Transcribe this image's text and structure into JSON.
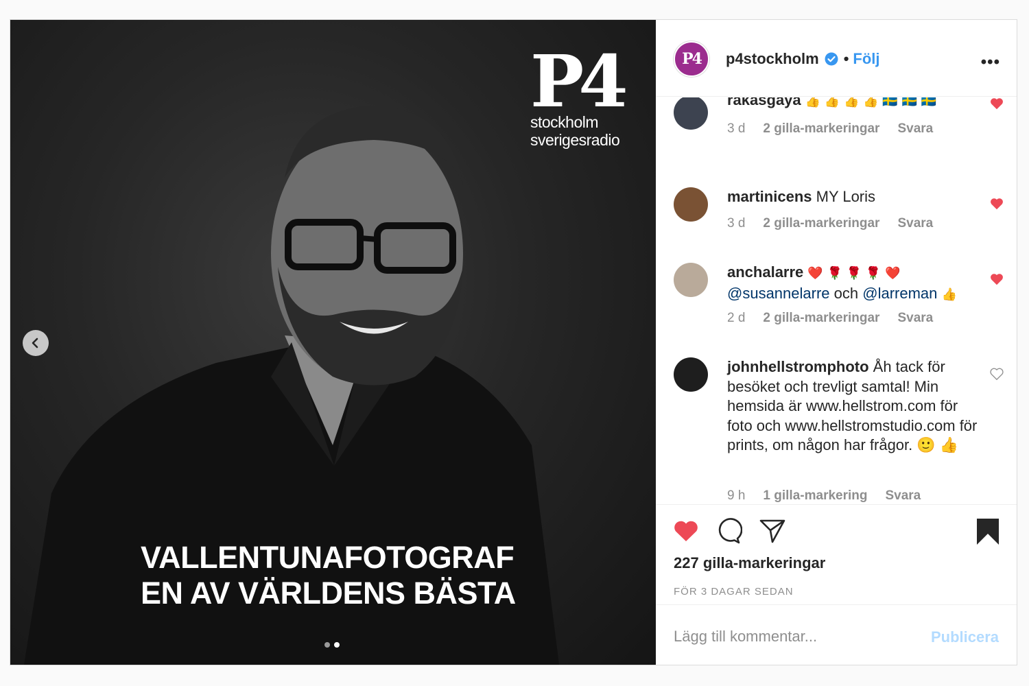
{
  "post": {
    "headline_line1": "VALLENTUNAFOTOGRAF",
    "headline_line2": "EN AV VÄRLDENS BÄSTA",
    "logo": {
      "mark": "P4",
      "line1": "stockholm",
      "line2": "sverigesradio"
    },
    "carousel": {
      "count": 2,
      "active_index": 1
    }
  },
  "header": {
    "username": "p4stockholm",
    "follow_label": "Följ",
    "more_label": "•••",
    "avatar_mark": "P4"
  },
  "comments": [
    {
      "user": "rakasgaya",
      "text": "👍 👍 👍 👍 🇸🇪 🇸🇪 🇸🇪",
      "time": "3 d",
      "likes": "2 gilla-markeringar",
      "reply": "Svara",
      "liked": true
    },
    {
      "user": "martinicens",
      "text": "MY Loris",
      "time": "3 d",
      "likes": "2 gilla-markeringar",
      "reply": "Svara",
      "liked": true
    },
    {
      "user": "anchalarre",
      "text": "❤️ 🌹 🌹 🌹 ❤️",
      "mention1": "@susannelarre",
      "and": "och",
      "mention2": "@larreman",
      "emoji_end": "👍",
      "time": "2 d",
      "likes": "2 gilla-markeringar",
      "reply": "Svara",
      "liked": true
    },
    {
      "user": "johnhellstromphoto",
      "text": "Åh tack för besöket och trevligt samtal! Min hemsida är www.hellstrom.com för foto och www.hellstromstudio.com för prints, om någon har frågor. 🙂 👍",
      "time": "9 h",
      "likes": "1 gilla-markering",
      "reply": "Svara",
      "liked": false
    }
  ],
  "actions": {
    "likes_count": "227 gilla-markeringar",
    "posted_ago": "FÖR 3 DAGAR SEDAN"
  },
  "add_comment": {
    "placeholder": "Lägg till kommentar...",
    "publish_label": "Publicera"
  },
  "colors": {
    "heart": "#ed4956",
    "link": "#3897f0",
    "mention": "#003569",
    "muted": "#8e8e8e"
  }
}
